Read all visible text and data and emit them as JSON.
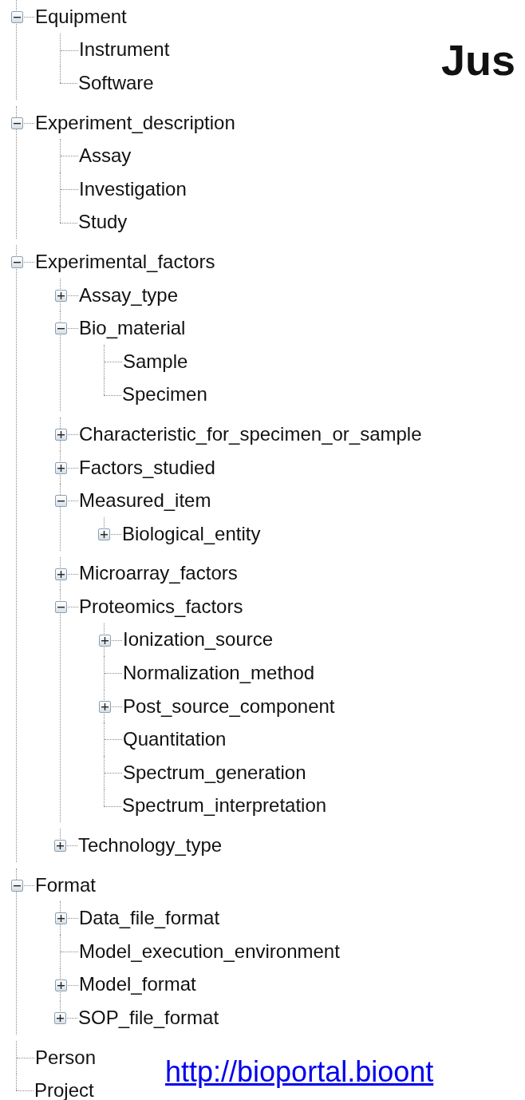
{
  "tree": [
    {
      "label": "Equipment",
      "expanded": true,
      "children": [
        {
          "label": "Instrument"
        },
        {
          "label": "Software"
        }
      ]
    },
    {
      "label": "Experiment_description",
      "expanded": true,
      "children": [
        {
          "label": "Assay"
        },
        {
          "label": "Investigation"
        },
        {
          "label": "Study"
        }
      ]
    },
    {
      "label": "Experimental_factors",
      "expanded": true,
      "children": [
        {
          "label": "Assay_type",
          "expanded": false
        },
        {
          "label": "Bio_material",
          "expanded": true,
          "children": [
            {
              "label": "Sample"
            },
            {
              "label": "Specimen"
            }
          ]
        },
        {
          "label": "Characteristic_for_specimen_or_sample",
          "expanded": false
        },
        {
          "label": "Factors_studied",
          "expanded": false
        },
        {
          "label": "Measured_item",
          "expanded": true,
          "children": [
            {
              "label": "Biological_entity",
              "expanded": false
            }
          ]
        },
        {
          "label": "Microarray_factors",
          "expanded": false
        },
        {
          "label": "Proteomics_factors",
          "expanded": true,
          "children": [
            {
              "label": "Ionization_source",
              "expanded": false
            },
            {
              "label": "Normalization_method"
            },
            {
              "label": "Post_source_component",
              "expanded": false
            },
            {
              "label": "Quantitation"
            },
            {
              "label": "Spectrum_generation"
            },
            {
              "label": "Spectrum_interpretation"
            }
          ]
        },
        {
          "label": "Technology_type",
          "expanded": false
        }
      ]
    },
    {
      "label": "Format",
      "expanded": true,
      "children": [
        {
          "label": "Data_file_format",
          "expanded": false
        },
        {
          "label": "Model_execution_environment"
        },
        {
          "label": "Model_format",
          "expanded": false
        },
        {
          "label": "SOP_file_format",
          "expanded": false
        }
      ]
    },
    {
      "label": "Person"
    },
    {
      "label": "Project"
    }
  ],
  "slide": {
    "title": "Jus",
    "link": "http://bioportal.bioont"
  }
}
